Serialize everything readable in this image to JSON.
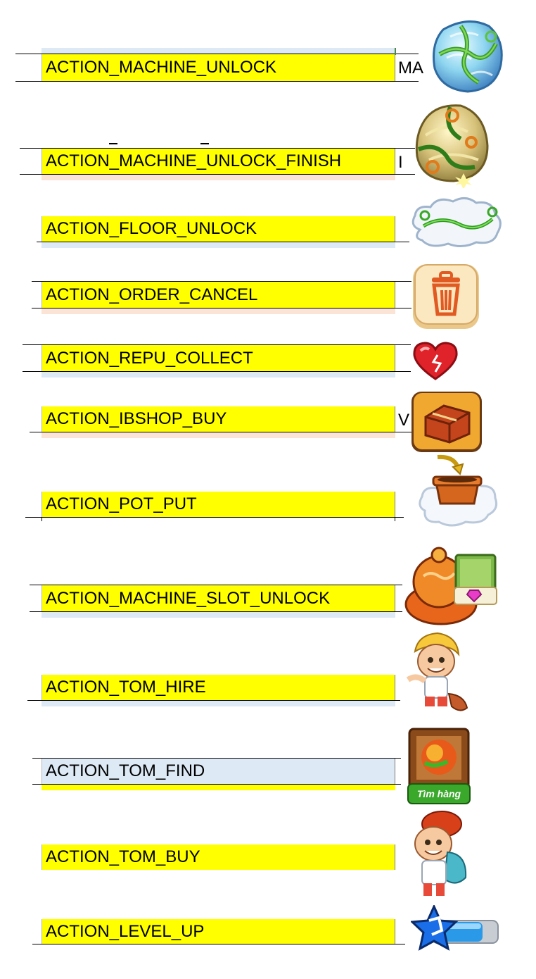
{
  "rows": [
    {
      "label": "ACTION_MACHINE_UNLOCK",
      "side": "MA",
      "icon": "crystal-vine-rock-icon"
    },
    {
      "label": "ACTION_MACHINE_UNLOCK_FINISH",
      "side": "I",
      "icon": "golden-vine-rock-icon"
    },
    {
      "label": "ACTION_FLOOR_UNLOCK",
      "side": "",
      "icon": "vine-cloud-icon"
    },
    {
      "label": "ACTION_ORDER_CANCEL",
      "side": "",
      "icon": "trash-can-icon"
    },
    {
      "label": "ACTION_REPU_COLLECT",
      "side": "",
      "icon": "heart-icon"
    },
    {
      "label": "ACTION_IBSHOP_BUY",
      "side": "V",
      "icon": "treasure-chest-icon"
    },
    {
      "label": "ACTION_POT_PUT",
      "side": "",
      "icon": "flower-pot-cloud-icon"
    },
    {
      "label": "ACTION_MACHINE_SLOT_UNLOCK",
      "side": "",
      "icon": "machine-slot-gem-icon"
    },
    {
      "label": "ACTION_TOM_HIRE",
      "side": "",
      "icon": "tom-hire-icon"
    },
    {
      "label": "ACTION_TOM_FIND",
      "side": "",
      "icon": "tom-find-box-icon"
    },
    {
      "label": "ACTION_TOM_BUY",
      "side": "",
      "icon": "tom-buy-icon"
    },
    {
      "label": "ACTION_LEVEL_UP",
      "side": "",
      "icon": "level-up-star-bar-icon"
    }
  ],
  "icons": {
    "tom_find_button_text": "Tìm hàng"
  },
  "colors": {
    "highlight": "#ffff00",
    "blue_cell": "#dde9f5",
    "peach_tint": "#fbe4d5"
  }
}
